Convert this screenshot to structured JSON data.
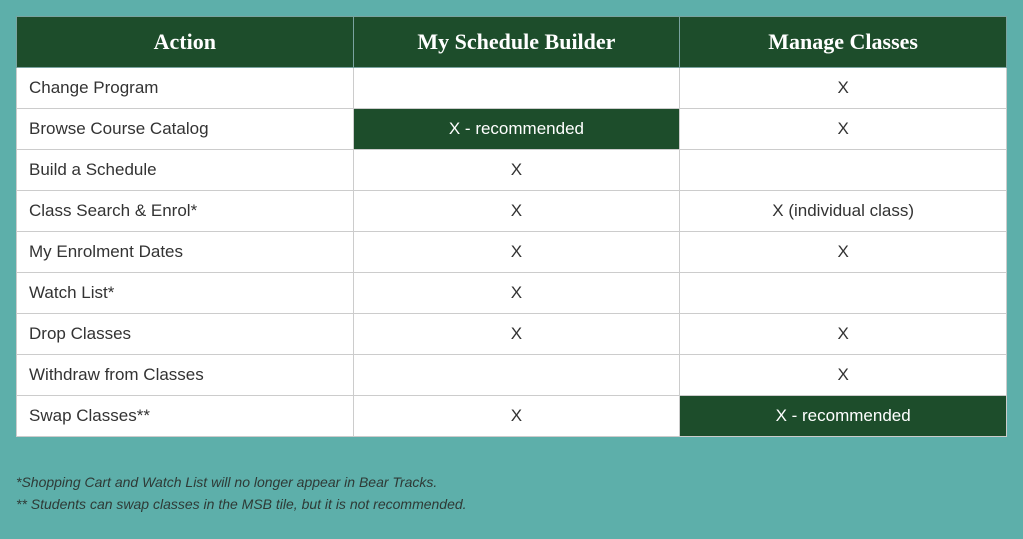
{
  "table": {
    "headers": [
      "Action",
      "My Schedule Builder",
      "Manage Classes"
    ],
    "rows": [
      {
        "action": "Change Program",
        "msb": "",
        "msb_rec": false,
        "mc": "X",
        "mc_rec": false
      },
      {
        "action": "Browse Course Catalog",
        "msb": "X - recommended",
        "msb_rec": true,
        "mc": "X",
        "mc_rec": false
      },
      {
        "action": "Build a Schedule",
        "msb": "X",
        "msb_rec": false,
        "mc": "",
        "mc_rec": false
      },
      {
        "action": "Class Search & Enrol*",
        "msb": "X",
        "msb_rec": false,
        "mc": "X (individual class)",
        "mc_rec": false
      },
      {
        "action": "My Enrolment Dates",
        "msb": "X",
        "msb_rec": false,
        "mc": "X",
        "mc_rec": false
      },
      {
        "action": "Watch List*",
        "msb": "X",
        "msb_rec": false,
        "mc": "",
        "mc_rec": false
      },
      {
        "action": "Drop Classes",
        "msb": "X",
        "msb_rec": false,
        "mc": "X",
        "mc_rec": false
      },
      {
        "action": "Withdraw from Classes",
        "msb": "",
        "msb_rec": false,
        "mc": "X",
        "mc_rec": false
      },
      {
        "action": "Swap Classes**",
        "msb": "X",
        "msb_rec": false,
        "mc": "X - recommended",
        "mc_rec": true
      }
    ]
  },
  "footnotes": [
    "*Shopping Cart and Watch List will no longer appear in Bear Tracks.",
    "** Students can swap classes in the MSB tile, but it is not recommended."
  ]
}
